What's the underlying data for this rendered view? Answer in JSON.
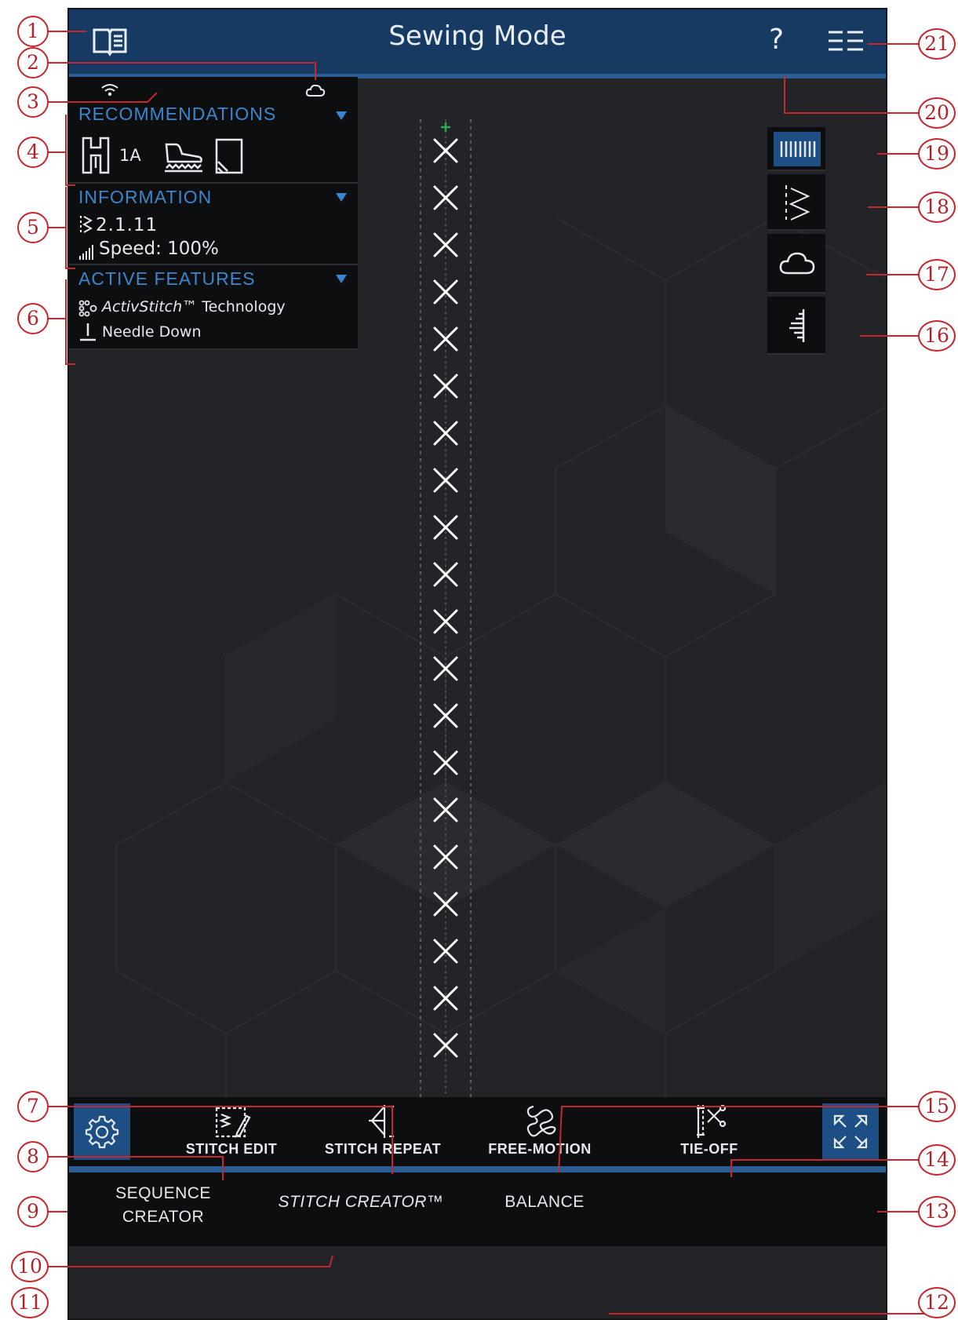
{
  "header": {
    "title": "Sewing Mode",
    "help_label": "?"
  },
  "recommendations": {
    "heading": "RECOMMENDATIONS",
    "presser_foot": "1A"
  },
  "information": {
    "heading": "INFORMATION",
    "stitch_number": "2.1.11",
    "speed_label": "Speed: 100%"
  },
  "active_features": {
    "heading": "ACTIVE FEATURES",
    "activstitch_name": "ActivStitch™",
    "activstitch_suffix": " Technology",
    "needle_down": "Needle Down"
  },
  "toolbar": {
    "stitch_edit": "STITCH EDIT",
    "stitch_repeat": "STITCH REPEAT",
    "free_motion": "FREE-MOTION",
    "tie_off": "TIE-OFF"
  },
  "tabs": {
    "sequence_creator_line1": "SEQUENCE",
    "sequence_creator_line2": "CREATOR",
    "stitch_creator": "STITCH CREATOR™",
    "balance": "BALANCE"
  },
  "callouts": [
    "1",
    "2",
    "3",
    "4",
    "5",
    "6",
    "7",
    "8",
    "9",
    "10",
    "11",
    "12",
    "13",
    "14",
    "15",
    "16",
    "17",
    "18",
    "19",
    "20",
    "21"
  ],
  "icons": {
    "manual": "book-icon",
    "wifi": "wifi-icon",
    "cloud": "cloud-icon",
    "help": "help-icon",
    "menu": "quick-menu-icon",
    "settings": "gear-icon",
    "zoom": "zoom-to-all-icon"
  },
  "colors": {
    "topbar": "#173a63",
    "accent_blue": "#3b86cc",
    "active_button": "#1d4f84",
    "screen_bg": "#232427",
    "callout_red": "#c6262d"
  }
}
